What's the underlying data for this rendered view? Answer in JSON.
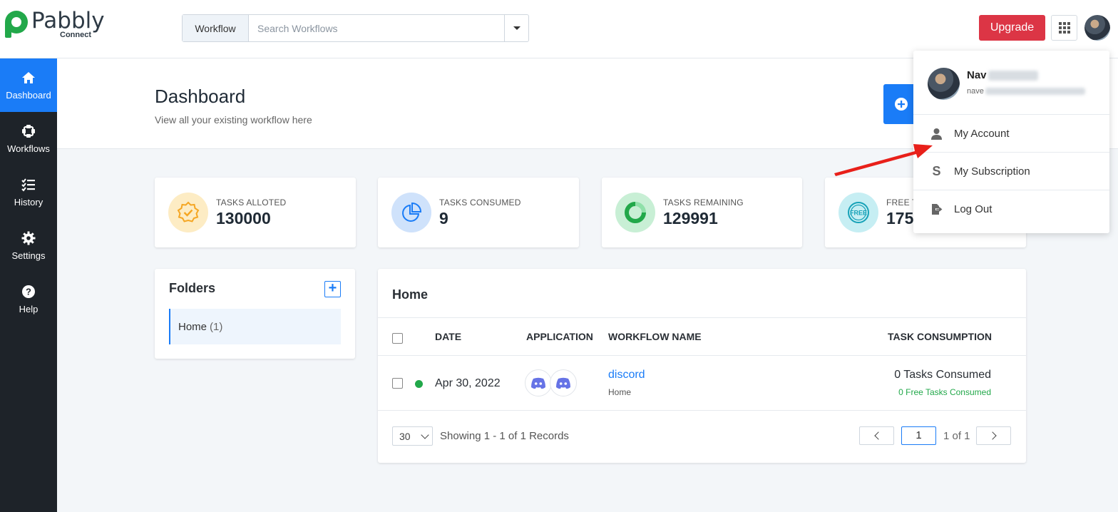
{
  "brand": {
    "name": "Pabbly",
    "sub": "Connect"
  },
  "header": {
    "search_type": "Workflow",
    "search_placeholder": "Search Workflows",
    "upgrade_label": "Upgrade"
  },
  "sidebar": {
    "items": [
      {
        "label": "Dashboard",
        "icon": "home-icon",
        "active": true
      },
      {
        "label": "Workflows",
        "icon": "workflow-icon"
      },
      {
        "label": "History",
        "icon": "history-icon"
      },
      {
        "label": "Settings",
        "icon": "gear-icon"
      },
      {
        "label": "Help",
        "icon": "help-icon"
      }
    ]
  },
  "page": {
    "title": "Dashboard",
    "subtitle": "View all your existing workflow here"
  },
  "stats": [
    {
      "label": "TASKS ALLOTED",
      "value": "130000",
      "icon": "badge-check-icon",
      "color": "#f5a623"
    },
    {
      "label": "TASKS CONSUMED",
      "value": "9",
      "icon": "pie-chart-icon",
      "color": "#1a7cf7"
    },
    {
      "label": "TASKS REMAINING",
      "value": "129991",
      "icon": "ring-chart-icon",
      "color": "#22a84a"
    },
    {
      "label": "FREE T",
      "value": "175",
      "icon": "free-badge-icon",
      "color": "#17a2b8"
    }
  ],
  "folders": {
    "title": "Folders",
    "items": [
      {
        "name": "Home",
        "count": "(1)"
      }
    ]
  },
  "home": {
    "title": "Home",
    "columns": [
      "DATE",
      "APPLICATION",
      "WORKFLOW NAME",
      "TASK CONSUMPTION"
    ],
    "rows": [
      {
        "status": "active",
        "date": "Apr 30, 2022",
        "apps": [
          "discord-icon",
          "discord-icon"
        ],
        "workflow_name": "discord",
        "folder": "Home",
        "tasks": "0 Tasks Consumed",
        "free_tasks": "0 Free Tasks Consumed"
      }
    ],
    "per_page": "30",
    "showing": "Showing 1 - 1 of 1 Records",
    "page_input": "1",
    "page_of": "1 of 1"
  },
  "user_menu": {
    "name_visible": "Nav",
    "email_visible": "nave",
    "items": [
      {
        "label": "My Account",
        "icon": "user-icon"
      },
      {
        "label": "My Subscription",
        "icon": "s-icon"
      },
      {
        "label": "Log Out",
        "icon": "logout-icon"
      }
    ]
  },
  "colors": {
    "primary": "#1a7cf7",
    "danger": "#dc3545",
    "sidebar": "#1e2329",
    "success": "#22a84a",
    "annotation_arrow": "#e8201a"
  }
}
